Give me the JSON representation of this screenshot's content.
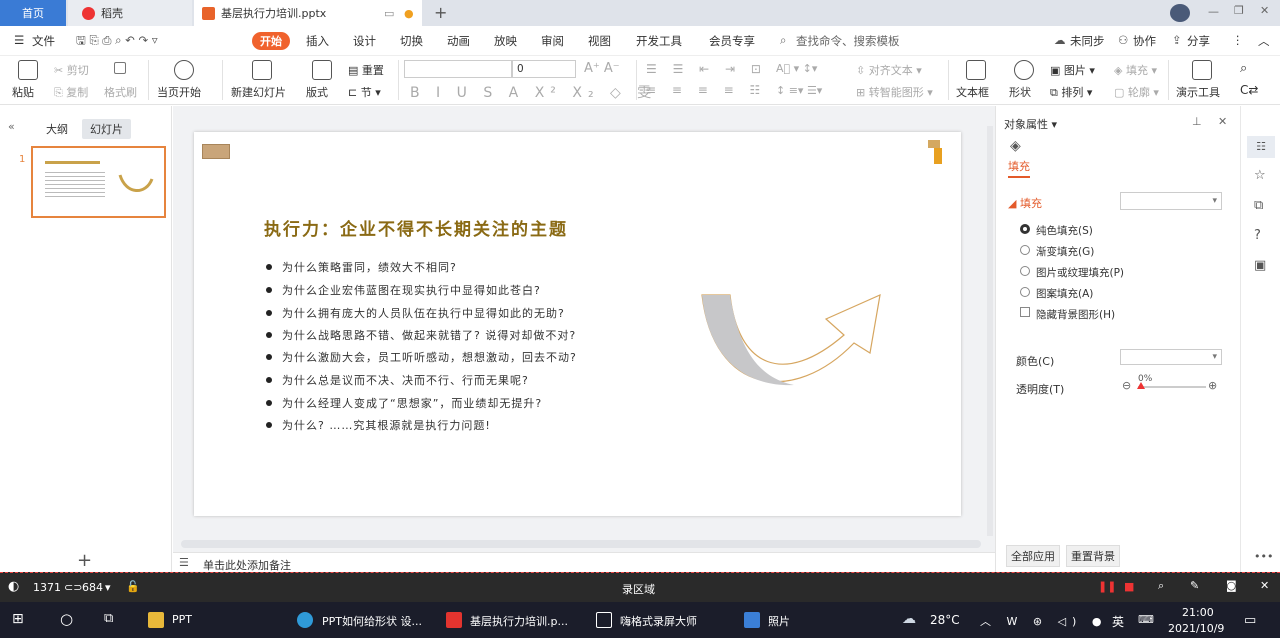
{
  "tabs": {
    "home": "首页",
    "daoke": "稻壳",
    "doc": "基层执行力培训.pptx"
  },
  "menu": {
    "file": "文件",
    "start": "开始",
    "insert": "插入",
    "design": "设计",
    "switch": "切换",
    "animation": "动画",
    "show": "放映",
    "review": "审阅",
    "view": "视图",
    "dev": "开发工具",
    "member": "会员专享",
    "search": "查找命令、搜索模板",
    "unsync": "未同步",
    "collab": "协作",
    "share": "分享"
  },
  "ribbon": {
    "paste": "粘贴",
    "cut": "剪切",
    "copy": "复制",
    "format_painter": "格式刷",
    "from_current": "当页开始",
    "new_slide": "新建幻灯片",
    "layout": "版式",
    "reset": "重置",
    "section": "节",
    "font_size": "0",
    "align_text": "对齐文本",
    "smart_shape": "转智能图形",
    "textbox": "文本框",
    "shape": "形状",
    "picture": "图片",
    "arrange": "排列",
    "fill": "填充",
    "outline": "轮廓",
    "present_tool": "演示工具"
  },
  "left": {
    "outline": "大纲",
    "slides": "幻灯片",
    "slide_num": "1"
  },
  "slide": {
    "title": "执行力：企业不得不长期关注的主题",
    "bullets": [
      "为什么策略雷同，绩效大不相同?",
      "为什么企业宏伟蓝图在现实执行中显得如此苍白?",
      "为什么拥有庞大的人员队伍在执行中显得如此的无助?",
      "为什么战略思路不错、做起来就错了? 说得对却做不对?",
      "为什么激励大会，员工听听感动，想想激动，回去不动?",
      "为什么总是议而不决、决而不行、行而无果呢?",
      "为什么经理人变成了“思想家”，而业绩却无提升?",
      "为什么? ……究其根源就是执行力问题!"
    ]
  },
  "notes": "单击此处添加备注",
  "right": {
    "title": "对象属性",
    "tab": "填充",
    "section": "填充",
    "options": [
      "纯色填充(S)",
      "渐变填充(G)",
      "图片或纹理填充(P)",
      "图案填充(A)"
    ],
    "hide_bg": "隐藏背景图形(H)",
    "color": "颜色(C)",
    "transparency": "透明度(T)",
    "transparency_val": "0%",
    "apply_all": "全部应用",
    "reset_bg": "重置背景"
  },
  "recbar": {
    "size_w": "1371",
    "size_h": "684",
    "label": "录区域"
  },
  "taskbar": {
    "ppt": "PPT",
    "edge": "PPT如何给形状 设...",
    "wps": "基层执行力培训.p...",
    "recorder": "嗨格式录屏大师",
    "photos": "照片",
    "temp": "28°C",
    "ime": "英",
    "time": "21:00",
    "date": "2021/10/9"
  },
  "colors": {
    "accent": "#f0622d",
    "title": "#8a6a14",
    "home_tab": "#3a7bd5"
  }
}
